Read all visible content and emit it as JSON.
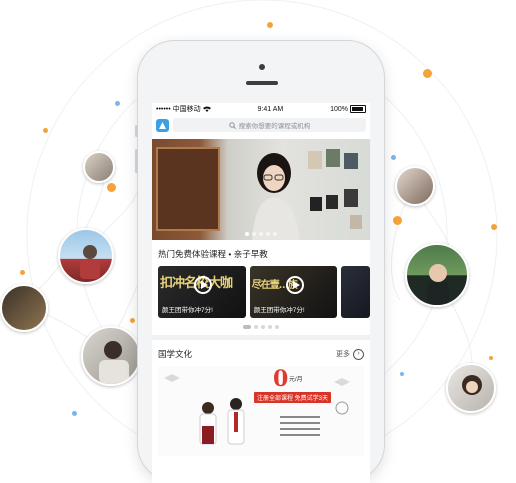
{
  "status_bar": {
    "carrier": "•••••• 中国移动",
    "time": "9:41 AM",
    "battery": "100%"
  },
  "search": {
    "placeholder": "搜索你想要的课程或机构"
  },
  "banner": {
    "slide_count": 5,
    "active_slide": 1
  },
  "free_courses": {
    "title": "热门免费体验课程 • 亲子早教",
    "videos": [
      {
        "headline": "扣冲名校大咖",
        "caption": "颜王团带你冲7分!"
      },
      {
        "headline": "尽在壹…族",
        "caption": "颜王团带你冲7分!"
      }
    ],
    "page_count": 5,
    "active_page": 0
  },
  "culture": {
    "title": "国学文化",
    "more_label": "更多",
    "ad": {
      "price": "0",
      "price_unit": "元/月",
      "promo": "注册全部课程 免费试学3天"
    }
  },
  "colors": {
    "accent_blue": "#3aa0e6",
    "orange_dot": "#f5a23a",
    "blue_dot": "#79b6ee",
    "ad_red": "#e03b2e"
  }
}
